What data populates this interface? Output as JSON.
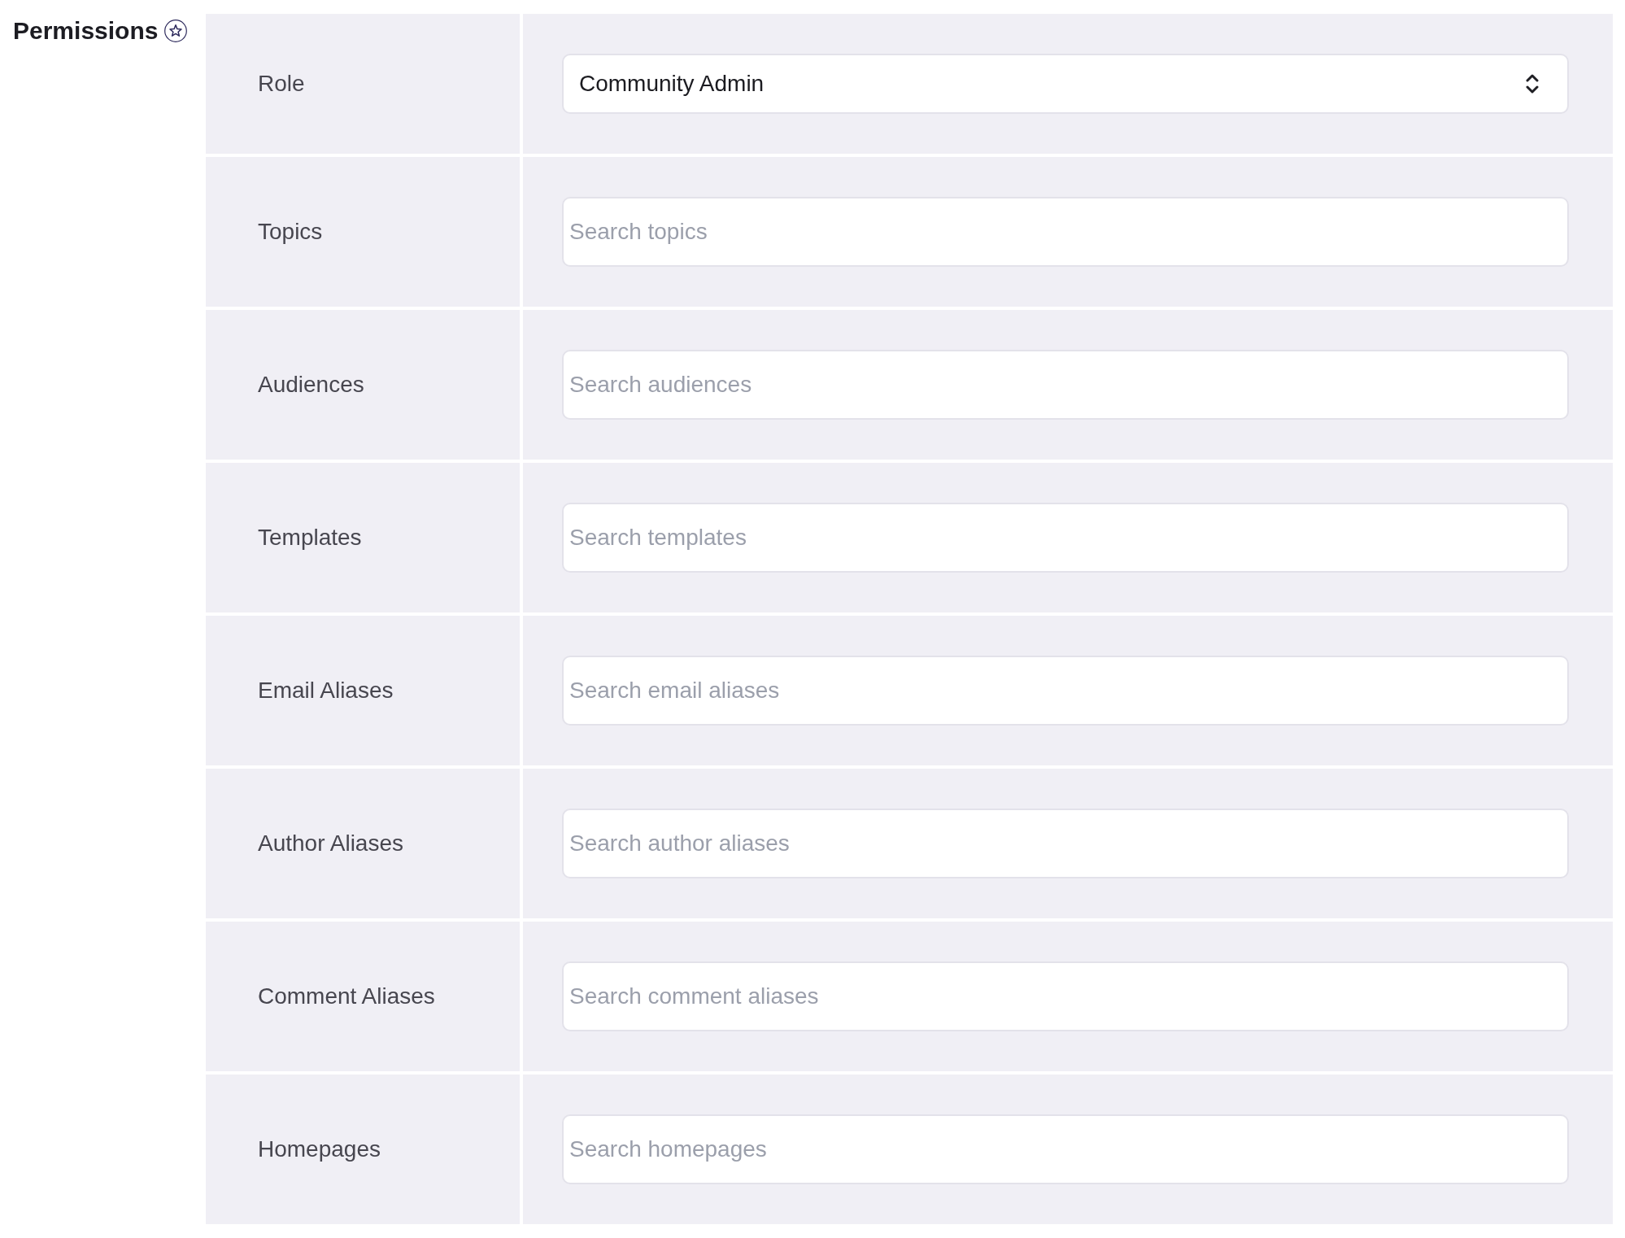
{
  "section": {
    "title": "Permissions"
  },
  "fields": [
    {
      "kind": "select",
      "label": "Role",
      "value": "Community Admin"
    },
    {
      "kind": "search",
      "label": "Topics",
      "placeholder": "Search topics"
    },
    {
      "kind": "search",
      "label": "Audiences",
      "placeholder": "Search audiences"
    },
    {
      "kind": "search",
      "label": "Templates",
      "placeholder": "Search templates"
    },
    {
      "kind": "search",
      "label": "Email Aliases",
      "placeholder": "Search email aliases"
    },
    {
      "kind": "search",
      "label": "Author Aliases",
      "placeholder": "Search author aliases"
    },
    {
      "kind": "search",
      "label": "Comment Aliases",
      "placeholder": "Search comment aliases"
    },
    {
      "kind": "search",
      "label": "Homepages",
      "placeholder": "Search homepages"
    }
  ]
}
